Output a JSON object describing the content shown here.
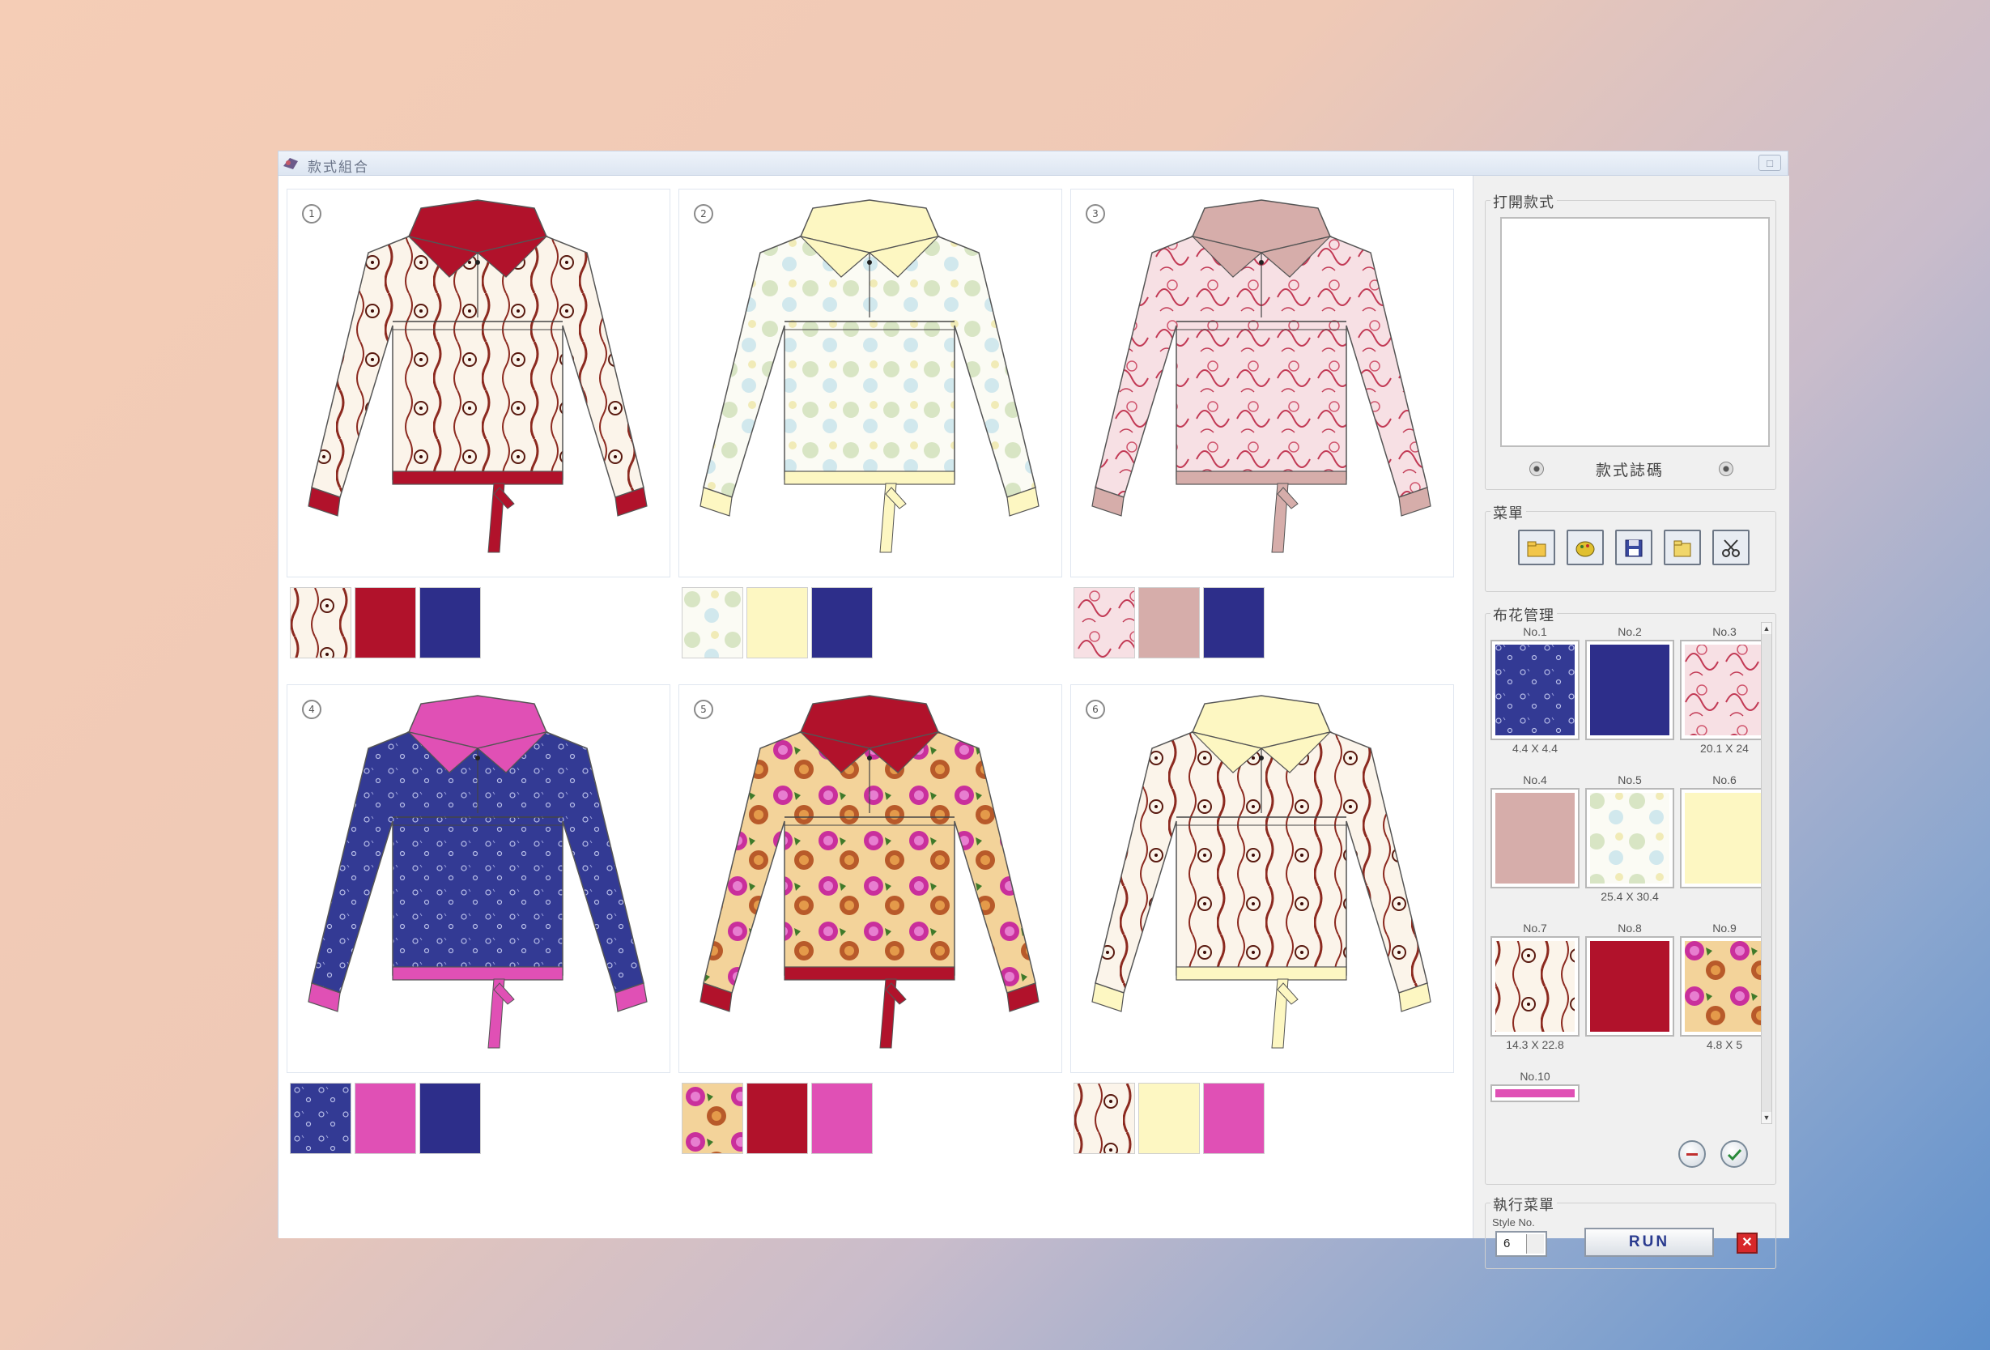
{
  "window": {
    "title": "款式組合",
    "close_label": "□"
  },
  "styles": [
    {
      "number": "1",
      "name": "style-1",
      "swatches": [
        "pattern-swirl",
        "#b1122b",
        "#2d2e8a"
      ]
    },
    {
      "number": "2",
      "name": "style-2",
      "swatches": [
        "pattern-lace-light",
        "#fdf7c2",
        "#2d2e8a"
      ]
    },
    {
      "number": "3",
      "name": "style-3",
      "swatches": [
        "pattern-pink-floral",
        "#d6adaa",
        "#2d2e8a"
      ]
    },
    {
      "number": "4",
      "name": "style-4",
      "swatches": [
        "pattern-navy-floral",
        "#e050b5",
        "#2d2e8a"
      ]
    },
    {
      "number": "5",
      "name": "style-5",
      "swatches": [
        "pattern-roses",
        "#b1122b",
        "#e050b5"
      ]
    },
    {
      "number": "6",
      "name": "style-6",
      "swatches": [
        "pattern-swirl",
        "#fdf7c2",
        "#e050b5"
      ]
    }
  ],
  "sidebar": {
    "open_style": {
      "label": "打開款式",
      "nav_label": "款式誌碼"
    },
    "menu": {
      "label": "菜單",
      "tools": [
        "open-folder-icon",
        "palette-icon",
        "save-disk-icon",
        "folder-icon",
        "scissors-icon"
      ]
    },
    "fabric": {
      "label": "布花管理",
      "items": [
        {
          "no": "No.1",
          "size": "4.4 X 4.4",
          "fill": "pattern-navy-floral"
        },
        {
          "no": "No.2",
          "size": "",
          "fill": "#2d2e8a"
        },
        {
          "no": "No.3",
          "size": "20.1 X 24",
          "fill": "pattern-pink-floral"
        },
        {
          "no": "No.4",
          "size": "",
          "fill": "#d6adaa"
        },
        {
          "no": "No.5",
          "size": "25.4 X 30.4",
          "fill": "pattern-lace-light"
        },
        {
          "no": "No.6",
          "size": "",
          "fill": "#fdf7c2"
        },
        {
          "no": "No.7",
          "size": "14.3 X 22.8",
          "fill": "pattern-swirl"
        },
        {
          "no": "No.8",
          "size": "",
          "fill": "#b1122b"
        },
        {
          "no": "No.9",
          "size": "4.8 X 5",
          "fill": "pattern-roses"
        },
        {
          "no": "No.10",
          "size": "",
          "fill": "#e050b5"
        }
      ]
    },
    "execute": {
      "label": "執行菜單",
      "style_no_label": "Style No.",
      "style_no_value": "6",
      "run_label": "RUN",
      "stop_label": "✕"
    }
  },
  "colors": {
    "titlebar": "#dde6f2",
    "navy": "#2d2e8a",
    "red": "#b1122b",
    "cream": "#fdf7c2",
    "pink": "#e050b5",
    "rose": "#d6adaa"
  }
}
